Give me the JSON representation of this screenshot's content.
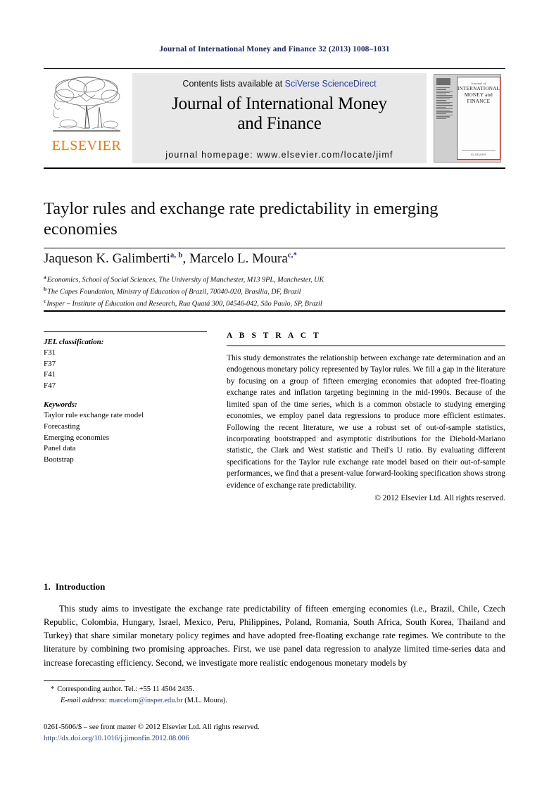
{
  "running_head": "Journal of International Money and Finance 32 (2013) 1008–1031",
  "masthead": {
    "publisher_name": "ELSEVIER",
    "contents_prefix": "Contents lists available at ",
    "contents_link": "SciVerse ScienceDirect",
    "journal_title_line1": "Journal of International Money",
    "journal_title_line2": "and Finance",
    "homepage": "journal homepage: www.elsevier.com/locate/jimf",
    "cover": {
      "kicker": "Journal of",
      "title": "INTERNATIONAL MONEY and FINANCE",
      "footer": "ELSEVIER"
    }
  },
  "article": {
    "title": "Taylor rules and exchange rate predictability in emerging economies",
    "authors_plain": "Jaqueson K. Galimberti",
    "author1_name": "Jaqueson K. Galimberti",
    "author1_sup": "a, b",
    "author_sep": ", ",
    "author2_name": "Marcelo L. Moura",
    "author2_sup": "c,*",
    "affiliations": [
      {
        "marker": "a",
        "text": "Economics, School of Social Sciences, The University of Manchester, M13 9PL, Manchester, UK"
      },
      {
        "marker": "b",
        "text": "The Capes Foundation, Ministry of Education of Brazil, 70040-020, Brasilia, DF, Brazil"
      },
      {
        "marker": "c",
        "text": "Insper – Institute of Education and Research, Rua Quatá 300, 04546-042, São Paulo, SP, Brazil"
      }
    ]
  },
  "info": {
    "jel_heading": "JEL classification:",
    "jel_codes": [
      "F31",
      "F37",
      "F41",
      "F47"
    ],
    "keywords_heading": "Keywords:",
    "keywords": [
      "Taylor rule exchange rate model",
      "Forecasting",
      "Emerging economies",
      "Panel data",
      "Bootstrap"
    ]
  },
  "abstract": {
    "heading": "A B S T R A C T",
    "text": "This study demonstrates the relationship between exchange rate determination and an endogenous monetary policy represented by Taylor rules. We fill a gap in the literature by focusing on a group of fifteen emerging economies that adopted free-floating exchange rates and inflation targeting beginning in the mid-1990s. Because of the limited span of the time series, which is a common obstacle to studying emerging economies, we employ panel data regressions to produce more efficient estimates. Following the recent literature, we use a robust set of out-of-sample statistics, incorporating bootstrapped and asymptotic distributions for the Diebold-Mariano statistic, the Clark and West statistic and Theil's U ratio. By evaluating different specifications for the Taylor rule exchange rate model based on their out-of-sample performances, we find that a present-value forward-looking specification shows strong evidence of exchange rate predictability.",
    "copyright": "© 2012 Elsevier Ltd. All rights reserved."
  },
  "body": {
    "section_number": "1.",
    "section_title": "Introduction",
    "paragraph1": "This study aims to investigate the exchange rate predictability of fifteen emerging economies (i.e., Brazil, Chile, Czech Republic, Colombia, Hungary, Israel, Mexico, Peru, Philippines, Poland, Romania, South Africa, South Korea, Thailand and Turkey) that share similar monetary policy regimes and have adopted free-floating exchange rate regimes. We contribute to the literature by combining two promising approaches. First, we use panel data regression to analyze limited time-series data and increase forecasting efficiency. Second, we investigate more realistic endogenous monetary models by"
  },
  "footnotes": {
    "star": "*",
    "corresponding": "Corresponding author. Tel.: +55 11 4504 2435.",
    "email_label": "E-mail address:",
    "email": "marcelom@insper.edu.br",
    "email_suffix": "(M.L. Moura)."
  },
  "imprint": {
    "line1": "0261-5606/$ – see front matter © 2012 Elsevier Ltd. All rights reserved.",
    "doi": "http://dx.doi.org/10.1016/j.jimonfin.2012.08.006"
  },
  "colors": {
    "running_head": "#1b2a6b",
    "link_blue": "#2b3f9e",
    "elsevier_orange": "#e87722",
    "cover_red": "#b8362f"
  }
}
